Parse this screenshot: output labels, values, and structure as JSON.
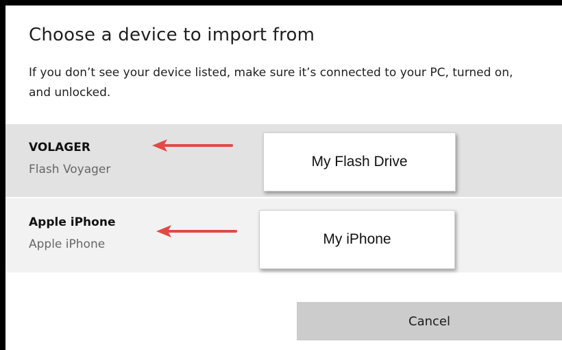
{
  "dialog": {
    "title": "Choose a device to import from",
    "message": "If you don’t see your device listed, make sure it’s connected to your PC, turned on, and unlocked.",
    "cancel_label": "Cancel"
  },
  "devices": [
    {
      "name": "VOLAGER",
      "subtitle": "Flash Voyager",
      "annotation": "My Flash Drive",
      "selected": true
    },
    {
      "name": "Apple iPhone",
      "subtitle": "Apple iPhone",
      "annotation": "My iPhone",
      "selected": false
    }
  ],
  "colors": {
    "annotation_arrow": "#e04a45",
    "selected_row": "#e2e2e2",
    "row": "#f2f2f2",
    "cancel_button": "#cccccc"
  },
  "icons": {
    "annotation_pointer": "red-arrow-left-icon"
  }
}
